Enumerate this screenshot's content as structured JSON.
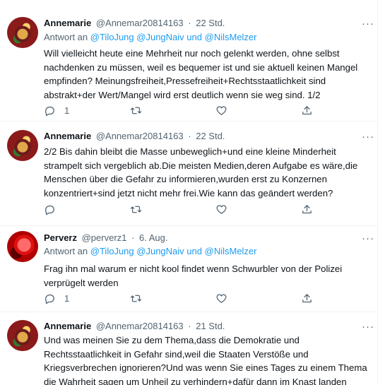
{
  "tweets": [
    {
      "name": "Annemarie",
      "handle": "@Annemar20814163",
      "sep": "·",
      "time": "22 Std.",
      "reply_prefix": "Antwort an",
      "reply_users": [
        "@TiloJung",
        "@JungNaiv"
      ],
      "reply_and": "und",
      "reply_last": "@NilsMelzer",
      "lines": [
        "Will vielleicht heute eine Mehrheit nur noch gelenkt werden, ohne selbst",
        "nachdenken zu müssen, weil es bequemer ist und sie aktuell keinen Mangel",
        "empfinden? Meinungsfreiheit,Pressefreiheit+Rechtsstaatlichkeit sind",
        "abstrakt+der Wert/Mangel wird erst deutlich wenn sie weg sind. 1/2"
      ],
      "reply_count": "1"
    },
    {
      "name": "Annemarie",
      "handle": "@Annemar20814163",
      "sep": "·",
      "time": "22 Std.",
      "lines": [
        "2/2 Bis dahin bleibt die Masse unbeweglich+und eine kleine Minderheit",
        "strampelt sich vergeblich ab.Die meisten Medien,deren Aufgabe es wäre,die",
        "Menschen über die Gefahr zu informieren,wurden erst zu Konzernen",
        "konzentriert+sind jetzt nicht mehr frei.Wie kann das geändert werden?"
      ],
      "reply_count": ""
    },
    {
      "name": "Perverz",
      "handle": "@perverz1",
      "sep": "·",
      "time": "6. Aug.",
      "reply_prefix": "Antwort an",
      "reply_users": [
        "@TiloJung",
        "@JungNaiv"
      ],
      "reply_and": "und",
      "reply_last": "@NilsMelzer",
      "lines": [
        "Frag ihn mal warum er nicht kool findet wenn Schwurbler von der Polizei",
        "verprügelt werden"
      ],
      "reply_count": "1"
    },
    {
      "name": "Annemarie",
      "handle": "@Annemar20814163",
      "sep": "·",
      "time": "21 Std.",
      "lines": [
        "Und was meinen Sie zu dem Thema,dass die Demokratie und",
        "Rechtsstaatlichkeit in Gefahr sind,weil die Staaten Verstöße und",
        "Kriegsverbrechen ignorieren?Und was wenn Sie eines Tages zu einem Thema",
        "die Wahrheit sagen um Unheil zu verhindern+dafür dann im Knast landen"
      ]
    }
  ],
  "icons": {
    "reply": "reply-icon",
    "retweet": "retweet-icon",
    "like": "heart-icon",
    "share": "share-icon",
    "more": "more-icon"
  },
  "colors": {
    "link": "#1d9bf0",
    "secondary_text": "#536471",
    "primary_text": "#0f1419",
    "divider": "#eff3f4"
  }
}
